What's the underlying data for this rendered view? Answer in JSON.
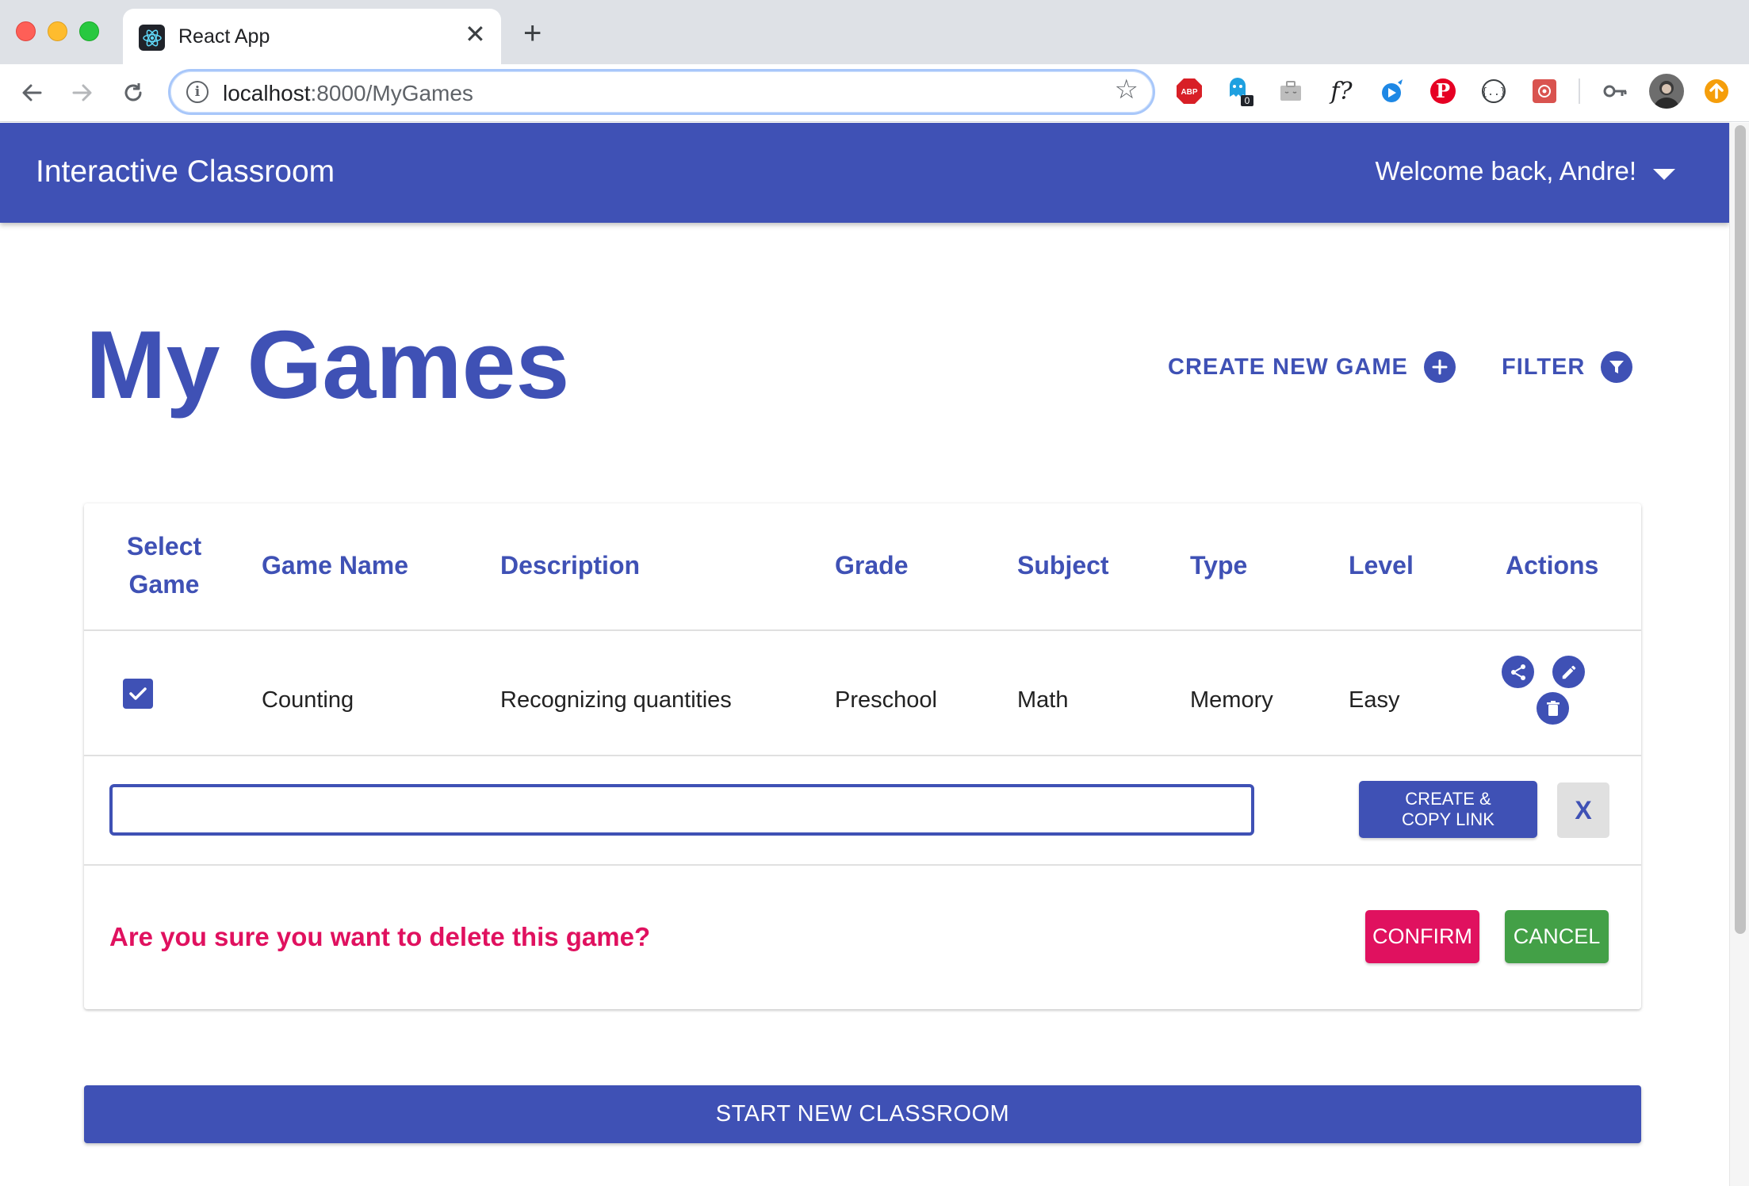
{
  "browser": {
    "tab_title": "React App",
    "url_host": "localhost",
    "url_rest": ":8000/MyGames",
    "ext_badge_count": "0"
  },
  "header": {
    "app_title": "Interactive Classroom",
    "welcome": "Welcome back, Andre!"
  },
  "page": {
    "title": "My Games",
    "create_new_game": "CREATE NEW GAME",
    "filter": "FILTER"
  },
  "table": {
    "columns": {
      "select_line1": "Select",
      "select_line2": "Game",
      "game_name": "Game Name",
      "description": "Description",
      "grade": "Grade",
      "subject": "Subject",
      "type": "Type",
      "level": "Level",
      "actions": "Actions"
    },
    "rows": [
      {
        "selected": true,
        "game_name": "Counting",
        "description": "Recognizing quantities",
        "grade": "Preschool",
        "subject": "Math",
        "type": "Memory",
        "level": "Easy"
      }
    ]
  },
  "share": {
    "link_value": "",
    "copy_line1": "CREATE &",
    "copy_line2": "COPY LINK",
    "close": "X"
  },
  "delete_confirm": {
    "message": "Are you sure you want to delete this game?",
    "confirm": "CONFIRM",
    "cancel": "CANCEL"
  },
  "footer": {
    "start_button": "START NEW CLASSROOM"
  },
  "colors": {
    "primary": "#3f51b5",
    "danger": "#e0115f",
    "success": "#43a047"
  },
  "icons": {
    "create": "add-circle-icon",
    "filter": "filter-icon",
    "share": "share-icon",
    "edit": "pencil-icon",
    "delete": "trash-icon",
    "checkbox": "checkmark-icon"
  }
}
